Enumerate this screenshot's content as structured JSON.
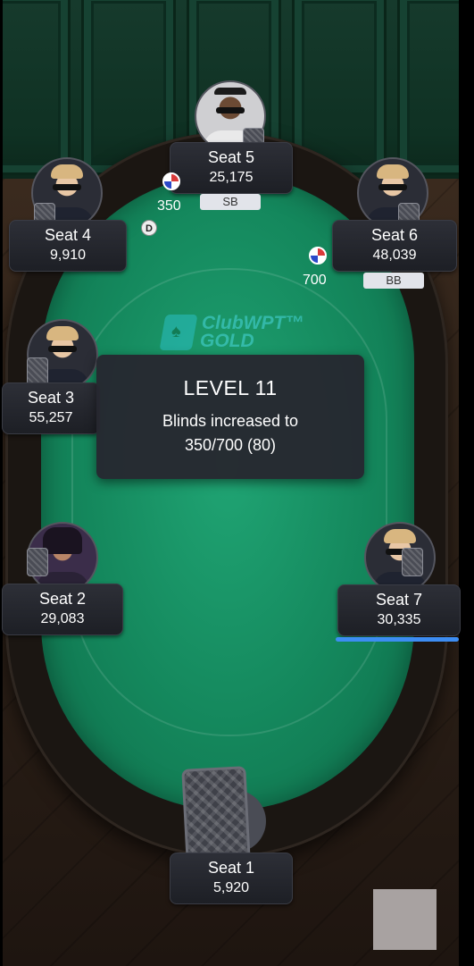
{
  "seats": {
    "s1": {
      "name": "Seat 1",
      "stack": "5,920"
    },
    "s2": {
      "name": "Seat 2",
      "stack": "29,083"
    },
    "s3": {
      "name": "Seat 3",
      "stack": "55,257"
    },
    "s4": {
      "name": "Seat 4",
      "stack": "9,910"
    },
    "s5": {
      "name": "Seat 5",
      "stack": "25,175",
      "position_tag": "SB"
    },
    "s6": {
      "name": "Seat 6",
      "stack": "48,039",
      "position_tag": "BB"
    },
    "s7": {
      "name": "Seat 7",
      "stack": "30,335"
    }
  },
  "bets": {
    "small_blind": "350",
    "big_blind": "700"
  },
  "dealer_button": "D",
  "logo": {
    "line1": "ClubWPT™",
    "line2": "GOLD"
  },
  "announcement": {
    "title": "LEVEL 11",
    "line1": "Blinds increased to",
    "line2": "350/700 (80)"
  },
  "colors": {
    "felt": "#14875c",
    "turn_indicator": "#3d8df2",
    "plate": "#26282f"
  }
}
